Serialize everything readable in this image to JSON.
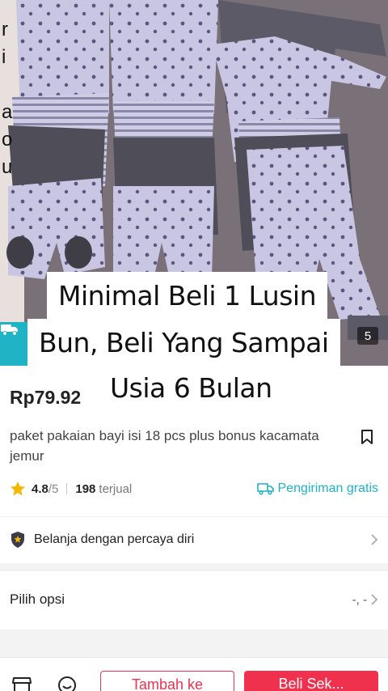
{
  "caption": {
    "line1": "Minimal Beli 1 Lusin",
    "line2": "Bun, Beli Yang Sampai",
    "line3": "Usia 6 Bulan"
  },
  "image": {
    "counter_partial": "5",
    "left_strip_chars": [
      "r",
      "i",
      "a",
      "o",
      "u"
    ]
  },
  "product": {
    "price": "Rp79.92",
    "title": "paket pakaian bayi isi 18 pcs plus bonus kacamata jemur",
    "rating": "4.8",
    "rating_max": "/5",
    "sold_count": "198",
    "sold_label": "terjual",
    "shipping": "Pengiriman gratis"
  },
  "trust": {
    "label": "Belanja dengan percaya diri"
  },
  "options": {
    "label": "Pilih opsi",
    "value": "-, -"
  },
  "bottom": {
    "add_to_cart": "Tambah ke",
    "buy_now": "Beli Sek..."
  },
  "colors": {
    "accent_red": "#f0314e",
    "accent_teal": "#20b2c5",
    "star": "#f5b800"
  },
  "icons": [
    "truck-icon",
    "bookmark-icon",
    "star-icon",
    "shipping-truck-icon",
    "shield-icon",
    "chevron-right-icon",
    "store-icon",
    "chat-icon"
  ]
}
